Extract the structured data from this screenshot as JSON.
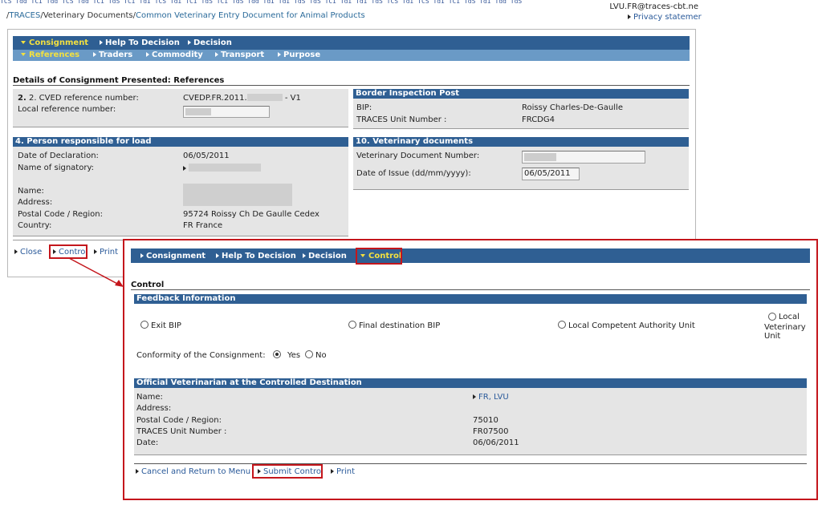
{
  "top": {
    "strip_text": "TCS Tdg TCI Tdd TCS Tdd TCI TdS TCI TdI TCS TdI TCI TdS TCI TdS Tdd TdI TdI TdS TdS TCI TdI TdI TdS TCS TdI TCS TdI TCI TdS TdI Tdd TdS",
    "user": "LVU.FR@traces-cbt.ne",
    "privacy": "Privacy statemer"
  },
  "breadcrumb": {
    "sep": "/",
    "items": [
      "TRACES",
      "Veterinary Documents",
      "Common Veterinary Entry Document for Animal Products"
    ]
  },
  "main": {
    "tabs": [
      {
        "label": "Consignment",
        "active": true
      },
      {
        "label": "Help To Decision",
        "active": false
      },
      {
        "label": "Decision",
        "active": false
      }
    ],
    "subtabs": [
      {
        "label": "References",
        "active": true
      },
      {
        "label": "Traders",
        "active": false
      },
      {
        "label": "Commodity",
        "active": false
      },
      {
        "label": "Transport",
        "active": false
      },
      {
        "label": "Purpose",
        "active": false
      }
    ],
    "section_title": "Details of Consignment Presented: References",
    "refs": {
      "cved_label": "2. CVED reference number:",
      "cved_value_prefix": "CVEDP.FR.2011.",
      "cved_value_suffix": "- V1",
      "local_ref_label": "Local reference number:"
    },
    "bip": {
      "title": "Border Inspection Post",
      "bip_label": "BIP:",
      "bip_value": "Roissy Charles-De-Gaulle",
      "unit_label": "TRACES Unit Number :",
      "unit_value": "FRCDG4"
    },
    "person": {
      "title": "4. Person responsible for load",
      "date_label": "Date of Declaration:",
      "date_value": "06/05/2011",
      "signatory_label": "Name of signatory:",
      "name_label": "Name:",
      "address_label": "Address:",
      "postal_label": "Postal Code / Region:",
      "postal_value": "95724 Roissy Ch De Gaulle Cedex",
      "country_label": "Country:",
      "country_value": "FR France"
    },
    "vetdocs": {
      "title": "10. Veterinary documents",
      "number_label": "Veterinary Document Number:",
      "issue_label": "Date of Issue (dd/mm/yyyy):",
      "issue_value": "06/05/2011"
    },
    "footer": {
      "close": "Close",
      "control": "Control",
      "print": "Print"
    }
  },
  "overlay": {
    "tabs": [
      {
        "label": "Consignment",
        "active": false
      },
      {
        "label": "Help To Decision",
        "active": false
      },
      {
        "label": "Decision",
        "active": false
      },
      {
        "label": "Control",
        "active": true
      }
    ],
    "section_title": "Control",
    "feedback": {
      "title": "Feedback Information",
      "options": [
        "Exit BIP",
        "Final destination BIP",
        "Local Competent Authority Unit",
        "Local",
        "Veterinary",
        "Unit"
      ],
      "conformity_label": "Conformity of the Consignment:",
      "yes": "Yes",
      "no": "No",
      "conformity_selected": "Yes"
    },
    "official": {
      "title": "Official Veterinarian at the Controlled Destination",
      "name_label": "Name:",
      "name_value": "FR, LVU",
      "address_label": "Address:",
      "postal_label": "Postal Code / Region:",
      "postal_value": "75010",
      "unit_label": "TRACES Unit Number :",
      "unit_value": "FR07500",
      "date_label": "Date:",
      "date_value": "06/06/2011"
    },
    "footer": {
      "cancel": "Cancel and Return to Menu",
      "submit": "Submit Contro",
      "print": "Print"
    }
  },
  "colors": {
    "tab_bar": "#2f5f93",
    "subtab_bar": "#6a9ac6",
    "active_tab": "#f2e040",
    "highlight": "#c4161c",
    "panel_bg": "#e5e5e5"
  }
}
